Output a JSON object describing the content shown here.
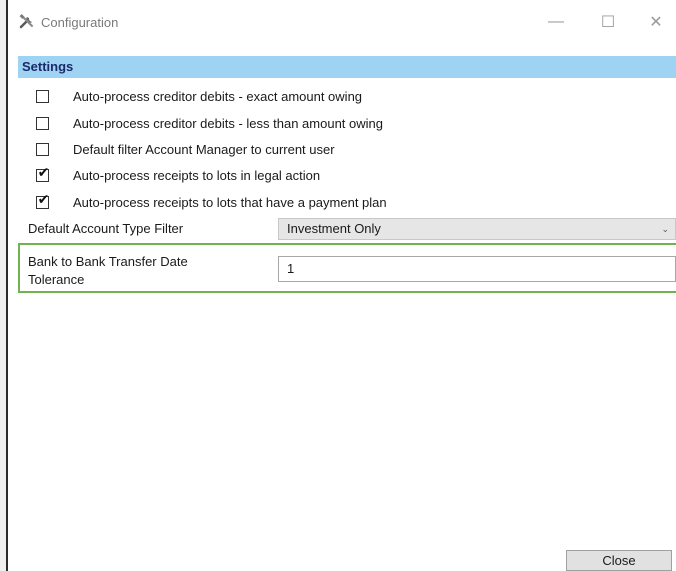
{
  "window": {
    "title": "Configuration",
    "minimize_glyph": "—",
    "maximize_glyph": "☐",
    "close_glyph": "✕",
    "app_icon": "tools-icon"
  },
  "settings": {
    "header": "Settings",
    "checkboxes": [
      {
        "label": "Auto-process creditor debits - exact amount owing",
        "checked": false
      },
      {
        "label": "Auto-process creditor debits - less than amount owing",
        "checked": false
      },
      {
        "label": "Default filter Account Manager to current user",
        "checked": false
      },
      {
        "label": "Auto-process receipts to lots in legal action",
        "checked": true
      },
      {
        "label": "Auto-process receipts to lots that have a payment plan",
        "checked": true
      }
    ],
    "check_glyph": "✔",
    "account_type": {
      "label": "Default Account Type Filter",
      "value": "Investment Only",
      "caret": "⌄"
    },
    "tolerance": {
      "label_line1": "Bank to Bank Transfer Date",
      "label_line2": "Tolerance",
      "value": "1"
    }
  },
  "footer": {
    "close_label": "Close"
  },
  "colors": {
    "header_bg": "#9fd3f4",
    "header_text": "#1b2b6a",
    "highlight_border": "#70b350"
  }
}
